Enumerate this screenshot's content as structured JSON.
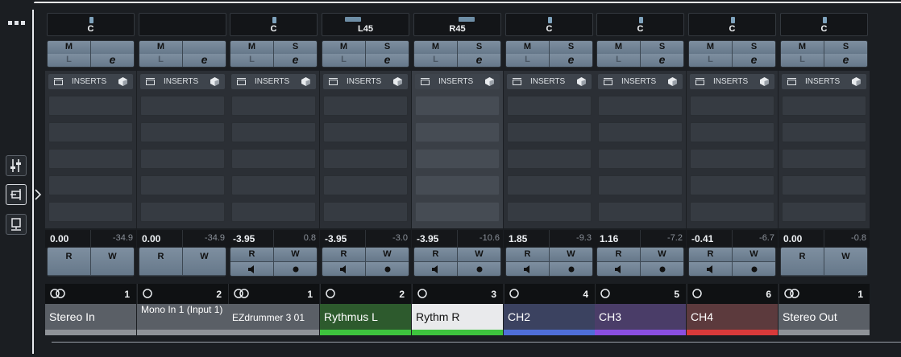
{
  "left_toolbar": {
    "buttons": [
      {
        "id": "mixer-icon",
        "active": false
      },
      {
        "id": "routing-icon",
        "active": true
      },
      {
        "id": "monitor-icon",
        "active": false
      }
    ]
  },
  "channels": [
    {
      "pan": "C",
      "mute": "M",
      "solo": "",
      "listen": "L",
      "edit": "e",
      "inserts_label": "INSERTS",
      "volume": "0.00",
      "peak": "-34.9",
      "read": "R",
      "write": "W",
      "rw_icons": false,
      "type_icon": "stereo",
      "number": "1",
      "name": "Stereo In",
      "name_style": "normal",
      "name_bg": "#5a5f66",
      "color": "#8f9398",
      "name_color": "#ffffff"
    },
    {
      "pan": "",
      "mute": "M",
      "solo": "",
      "listen": "L",
      "edit": "e",
      "inserts_label": "INSERTS",
      "volume": "0.00",
      "peak": "-34.9",
      "read": "R",
      "write": "W",
      "rw_icons": false,
      "type_icon": "mono",
      "number": "2",
      "name": "Mono In 1 (Input 1)",
      "name_style": "two",
      "name_bg": "#5a5f66",
      "color": "#8f9398",
      "name_color": "#ffffff"
    },
    {
      "pan": "C",
      "mute": "M",
      "solo": "S",
      "listen": "L",
      "edit": "e",
      "inserts_label": "INSERTS",
      "volume": "-3.95",
      "peak": "0.8",
      "read": "R",
      "write": "W",
      "rw_icons": true,
      "type_icon": "stereo",
      "number": "1",
      "name": "EZdrummer 3 01",
      "name_style": "small",
      "name_bg": "#5a5f66",
      "color": "#8f9398",
      "name_color": "#ffffff"
    },
    {
      "pan": "L45",
      "mute": "M",
      "solo": "S",
      "listen": "L",
      "edit": "e",
      "inserts_label": "INSERTS",
      "volume": "-3.95",
      "peak": "-3.0",
      "read": "R",
      "write": "W",
      "rw_icons": true,
      "type_icon": "mono",
      "number": "2",
      "name": "Rythmus L",
      "name_style": "normal",
      "name_bg": "#2d5a2d",
      "color": "#3ec43e",
      "name_color": "#ffffff"
    },
    {
      "pan": "R45",
      "mute": "M",
      "solo": "S",
      "listen": "L",
      "edit": "e",
      "inserts_label": "INSERTS",
      "volume": "-3.95",
      "peak": "-10.6",
      "read": "R",
      "write": "W",
      "rw_icons": true,
      "type_icon": "mono",
      "number": "3",
      "name": "Rythm R",
      "name_style": "normal",
      "name_bg": "#e9eaec",
      "color": "#3ec43e",
      "name_color": "#111111",
      "selected": true
    },
    {
      "pan": "C",
      "mute": "M",
      "solo": "S",
      "listen": "L",
      "edit": "e",
      "inserts_label": "INSERTS",
      "volume": "1.85",
      "peak": "-9.3",
      "read": "R",
      "write": "W",
      "rw_icons": true,
      "type_icon": "mono",
      "number": "4",
      "name": "CH2",
      "name_style": "normal",
      "name_bg": "#3b4260",
      "color": "#4f6fd8",
      "name_color": "#ffffff"
    },
    {
      "pan": "C",
      "mute": "M",
      "solo": "S",
      "listen": "L",
      "edit": "e",
      "inserts_label": "INSERTS",
      "volume": "1.16",
      "peak": "-7.2",
      "read": "R",
      "write": "W",
      "rw_icons": true,
      "type_icon": "mono",
      "number": "5",
      "name": "CH3",
      "name_style": "normal",
      "name_bg": "#4a3d68",
      "color": "#8a4fe0",
      "name_color": "#ffffff"
    },
    {
      "pan": "C",
      "mute": "M",
      "solo": "S",
      "listen": "L",
      "edit": "e",
      "inserts_label": "INSERTS",
      "volume": "-0.41",
      "peak": "-6.7",
      "read": "R",
      "write": "W",
      "rw_icons": true,
      "type_icon": "mono",
      "number": "6",
      "name": "CH4",
      "name_style": "normal",
      "name_bg": "#5c3a3d",
      "color": "#d83a3a",
      "name_color": "#ffffff"
    },
    {
      "pan": "C",
      "mute": "M",
      "solo": "S",
      "listen": "L",
      "edit": "e",
      "inserts_label": "INSERTS",
      "volume": "0.00",
      "peak": "-0.8",
      "read": "R",
      "write": "W",
      "rw_icons": false,
      "type_icon": "stereo",
      "number": "1",
      "name": "Stereo Out",
      "name_style": "normal",
      "name_bg": "#5a5f66",
      "color": "#8f9398",
      "name_color": "#ffffff"
    }
  ]
}
